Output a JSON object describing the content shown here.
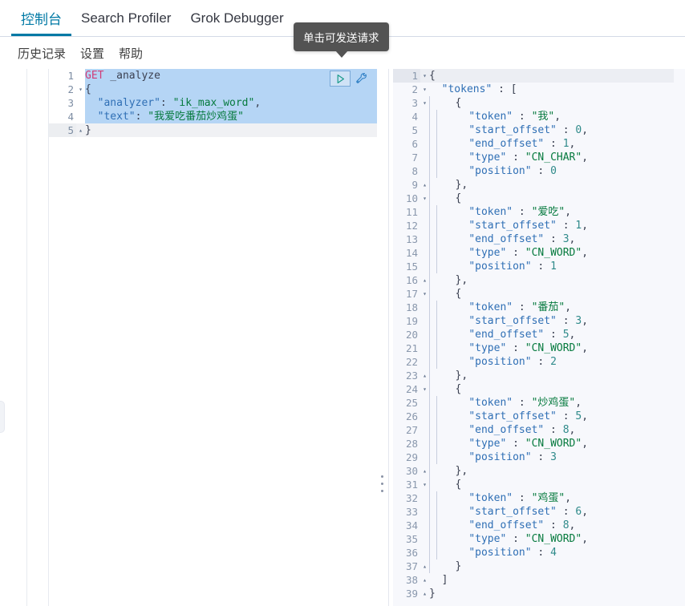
{
  "tabs": [
    {
      "label": "控制台",
      "active": true
    },
    {
      "label": "Search Profiler",
      "active": false
    },
    {
      "label": "Grok Debugger",
      "active": false
    }
  ],
  "toolbar": {
    "history_label": "历史记录",
    "settings_label": "设置",
    "help_label": "帮助"
  },
  "tooltip": {
    "text": "单击可发送请求"
  },
  "actions": {
    "play_icon": "play-triangle-icon",
    "wrench_icon": "wrench-icon"
  },
  "request_editor": {
    "method": "GET",
    "url": "_analyze",
    "body_analyzer_key": "\"analyzer\"",
    "body_analyzer_value": "\"ik_max_word\"",
    "body_text_key": "\"text\"",
    "body_text_value": "\"我爱吃番茄炒鸡蛋\"",
    "lines": [
      {
        "n": "1",
        "fold": "",
        "selected": true,
        "current": false
      },
      {
        "n": "2",
        "fold": "▾",
        "selected": true,
        "current": false
      },
      {
        "n": "3",
        "fold": "",
        "selected": true,
        "current": false
      },
      {
        "n": "4",
        "fold": "",
        "selected": true,
        "current": false
      },
      {
        "n": "5",
        "fold": "▴",
        "selected": false,
        "current": true
      }
    ]
  },
  "response_editor": {
    "root_key": "\"tokens\"",
    "total_lines": 39,
    "tokens": [
      {
        "token": "\"我\"",
        "start_offset": "0",
        "end_offset": "1",
        "type": "\"CN_CHAR\"",
        "position": "0"
      },
      {
        "token": "\"爱吃\"",
        "start_offset": "1",
        "end_offset": "3",
        "type": "\"CN_WORD\"",
        "position": "1"
      },
      {
        "token": "\"番茄\"",
        "start_offset": "3",
        "end_offset": "5",
        "type": "\"CN_WORD\"",
        "position": "2"
      },
      {
        "token": "\"炒鸡蛋\"",
        "start_offset": "5",
        "end_offset": "8",
        "type": "\"CN_WORD\"",
        "position": "3"
      },
      {
        "token": "\"鸡蛋\"",
        "start_offset": "6",
        "end_offset": "8",
        "type": "\"CN_WORD\"",
        "position": "4"
      }
    ],
    "field_labels": {
      "token": "\"token\"",
      "start_offset": "\"start_offset\"",
      "end_offset": "\"end_offset\"",
      "type": "\"type\"",
      "position": "\"position\""
    }
  }
}
